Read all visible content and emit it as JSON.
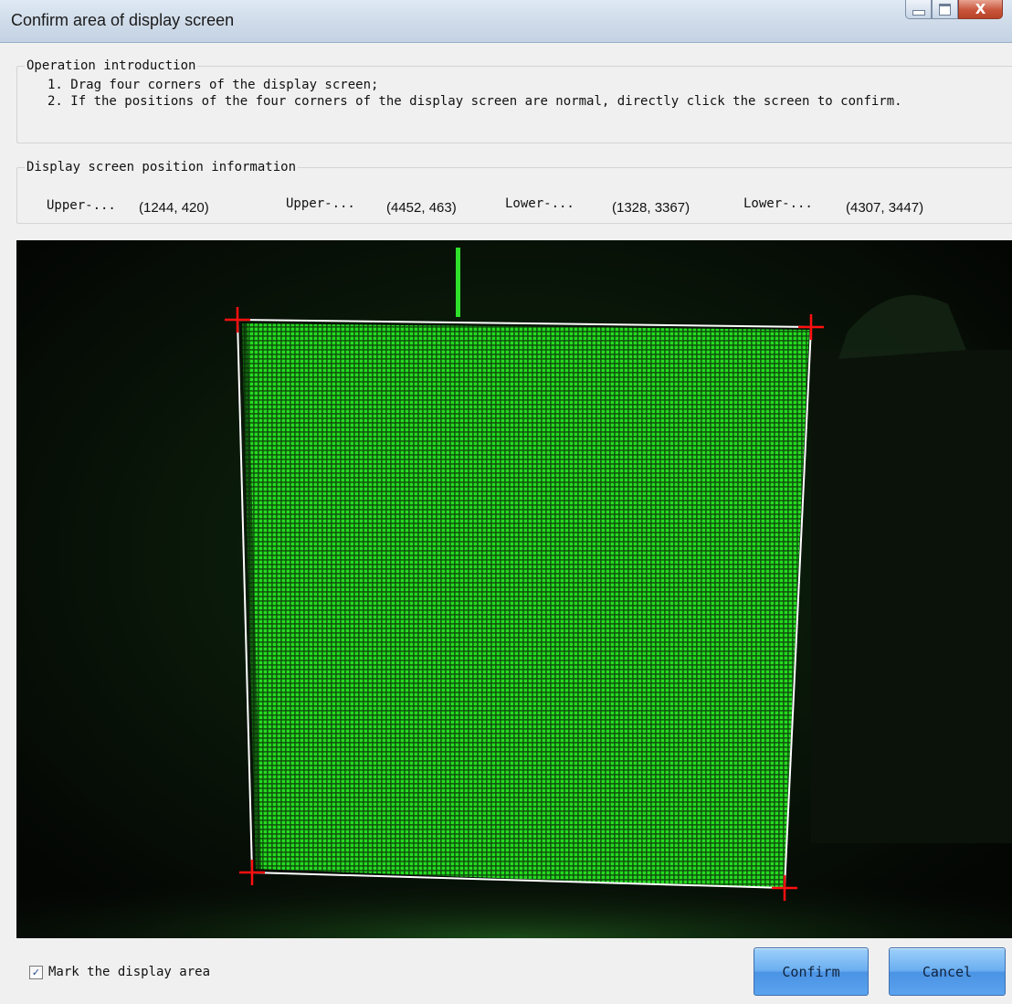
{
  "window": {
    "title": "Confirm area of display screen",
    "close_glyph": "X",
    "buttons": [
      "minimize-icon",
      "maximize-icon",
      "close-icon"
    ]
  },
  "operation_intro": {
    "legend": "Operation introduction",
    "steps": [
      "1. Drag four corners of the display screen;",
      "2. If the positions of the four corners of the display screen are normal, directly click the screen to confirm."
    ]
  },
  "position_info": {
    "legend": "Display screen position information",
    "corners": [
      {
        "label": "Upper-...",
        "value": "(1244, 420)"
      },
      {
        "label": "Upper-...",
        "value": "(4452, 463)"
      },
      {
        "label": "Lower-...",
        "value": "(1328, 3367)"
      },
      {
        "label": "Lower-...",
        "value": "(4307, 3447)"
      }
    ]
  },
  "image": {
    "led_color": "#22d81e",
    "marker_color": "#ff1010",
    "outline_color": "#ffffff",
    "markers": [
      "corner-marker-icon",
      "corner-marker-icon",
      "corner-marker-icon",
      "corner-marker-icon"
    ]
  },
  "footer": {
    "mark_checkbox_label": "Mark the display area",
    "mark_checked": true,
    "confirm_label": "Confirm",
    "cancel_label": "Cancel"
  }
}
